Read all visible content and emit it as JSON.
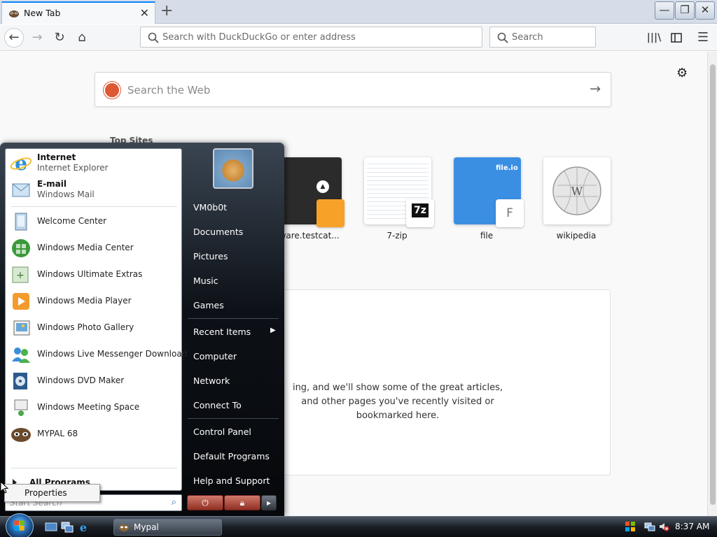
{
  "browser": {
    "tab_title": "New Tab",
    "url_placeholder": "Search with DuckDuckGo or enter address",
    "search_placeholder": "Search"
  },
  "newtab": {
    "web_search_placeholder": "Search the Web",
    "top_sites_label": "Top Sites",
    "top_sites": [
      {
        "label": "lware.testcat...",
        "badge": "",
        "color": "#2b2b2b"
      },
      {
        "label": "7-zip",
        "badge": "7z",
        "color": "#ffffff"
      },
      {
        "label": "file",
        "badge": "F",
        "color": "#3b8fe3"
      },
      {
        "label": "wikipedia",
        "badge": "",
        "color": "#ffffff"
      }
    ],
    "highlights_text": [
      "ing, and we'll show some of the great articles,",
      "and other pages you've recently visited or",
      "bookmarked here."
    ]
  },
  "start_menu": {
    "pinned": [
      {
        "name": "Internet",
        "sub": "Internet Explorer",
        "icon": "internet-explorer-icon"
      },
      {
        "name": "E-mail",
        "sub": "Windows Mail",
        "icon": "windows-mail-icon"
      }
    ],
    "programs": [
      {
        "label": "Welcome Center",
        "icon": "welcome-center-icon"
      },
      {
        "label": "Windows Media Center",
        "icon": "media-center-icon"
      },
      {
        "label": "Windows Ultimate Extras",
        "icon": "ultimate-extras-icon"
      },
      {
        "label": "Windows Media Player",
        "icon": "media-player-icon"
      },
      {
        "label": "Windows Photo Gallery",
        "icon": "photo-gallery-icon"
      },
      {
        "label": "Windows Live Messenger Download",
        "icon": "messenger-icon"
      },
      {
        "label": "Windows DVD Maker",
        "icon": "dvd-maker-icon"
      },
      {
        "label": "Windows Meeting Space",
        "icon": "meeting-space-icon"
      },
      {
        "label": "MYPAL 68",
        "icon": "mypal-icon"
      }
    ],
    "all_programs": "All Programs",
    "search_placeholder": "Start Search",
    "right": {
      "user": "VM0b0t",
      "documents": "Documents",
      "pictures": "Pictures",
      "music": "Music",
      "games": "Games",
      "recent_items": "Recent Items",
      "computer": "Computer",
      "network": "Network",
      "connect_to": "Connect To",
      "control_panel": "Control Panel",
      "default_programs": "Default Programs",
      "help_support": "Help and Support"
    }
  },
  "context_menu": {
    "properties": "Properties"
  },
  "taskbar": {
    "task_label": "Mypal",
    "clock": "8:37 AM"
  }
}
